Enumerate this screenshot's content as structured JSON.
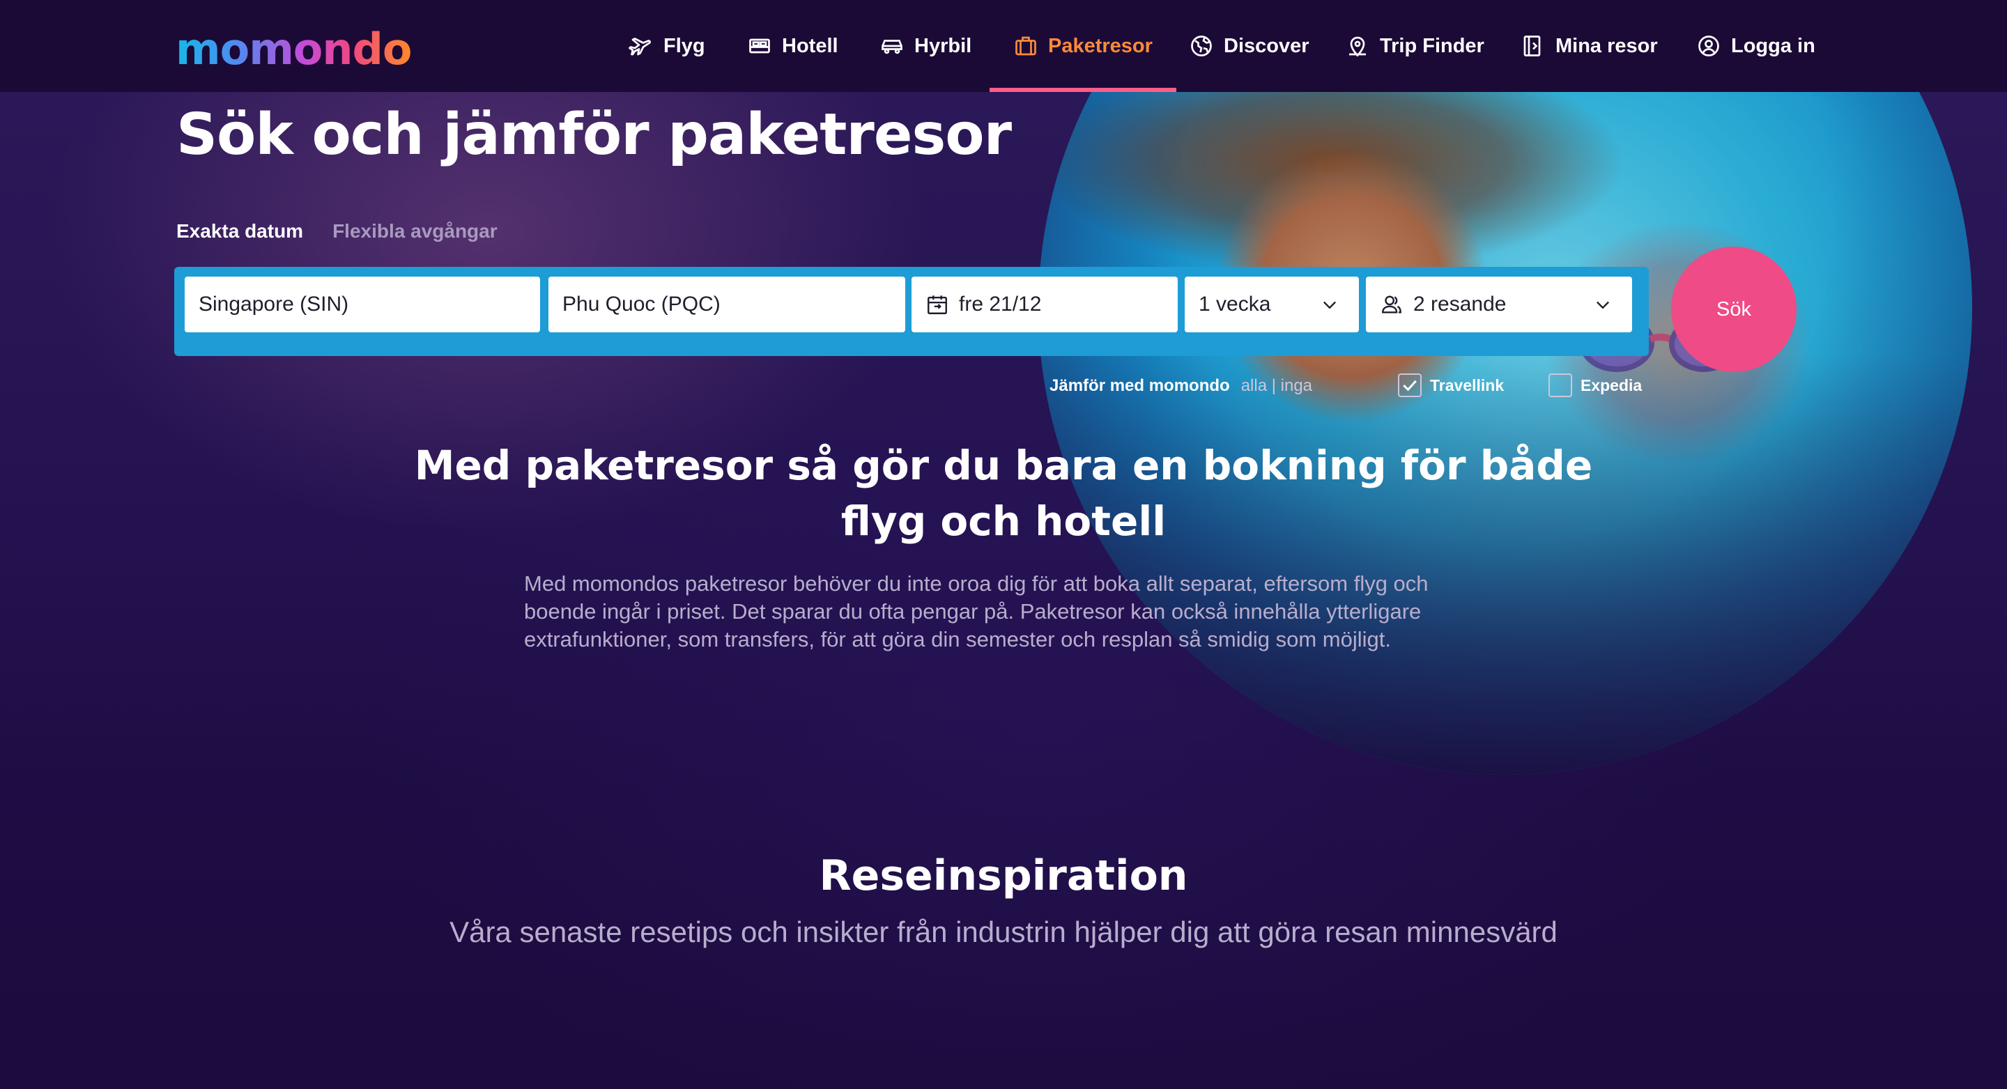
{
  "brand": {
    "logo_text": "momondo"
  },
  "nav": {
    "items": [
      {
        "label": "Flyg",
        "icon": "plane-icon"
      },
      {
        "label": "Hotell",
        "icon": "bed-icon"
      },
      {
        "label": "Hyrbil",
        "icon": "car-icon"
      },
      {
        "label": "Paketresor",
        "icon": "suitcase-icon",
        "active": true
      },
      {
        "label": "Discover",
        "icon": "globe-icon"
      },
      {
        "label": "Trip Finder",
        "icon": "map-pin-icon"
      },
      {
        "label": "Mina resor",
        "icon": "trips-icon"
      },
      {
        "label": "Logga in",
        "icon": "user-icon"
      }
    ]
  },
  "hero": {
    "title": "Sök och jämför paketresor",
    "tabs": [
      {
        "label": "Exakta datum",
        "active": true
      },
      {
        "label": "Flexibla avgångar",
        "active": false
      }
    ]
  },
  "search": {
    "origin": "Singapore (SIN)",
    "destination": "Phu Quoc (PQC)",
    "date": "fre 21/12",
    "duration": "1 vecka",
    "travelers": "2 resande",
    "submit_label": "Sök"
  },
  "compare": {
    "label": "Jämför med momondo",
    "all": "alla",
    "separator": "|",
    "none": "inga",
    "providers": [
      {
        "name": "Travellink",
        "checked": true
      },
      {
        "name": "Expedia",
        "checked": false
      }
    ]
  },
  "promo": {
    "title": "Med paketresor så gör du bara en bokning för både flyg och hotell",
    "body": "Med momondos paketresor behöver du inte oroa dig för att boka allt separat, eftersom flyg och boende ingår i priset. Det sparar du ofta pengar på. Paketresor kan också innehålla ytterligare extrafunktioner, som transfers, för att göra din semester och resplan så smidig som möjligt."
  },
  "inspiration": {
    "title": "Reseinspiration",
    "subtitle": "Våra senaste resetips och insikter från industrin hjälper dig att göra resan minnesvärd"
  },
  "colors": {
    "header_bg": "#1b0a36",
    "hero_bg": "#241250",
    "search_bar": "#1e9cd6",
    "search_button": "#ef4b86",
    "active_nav": "#ff8a3a",
    "active_underline": "#ff5c8a"
  }
}
